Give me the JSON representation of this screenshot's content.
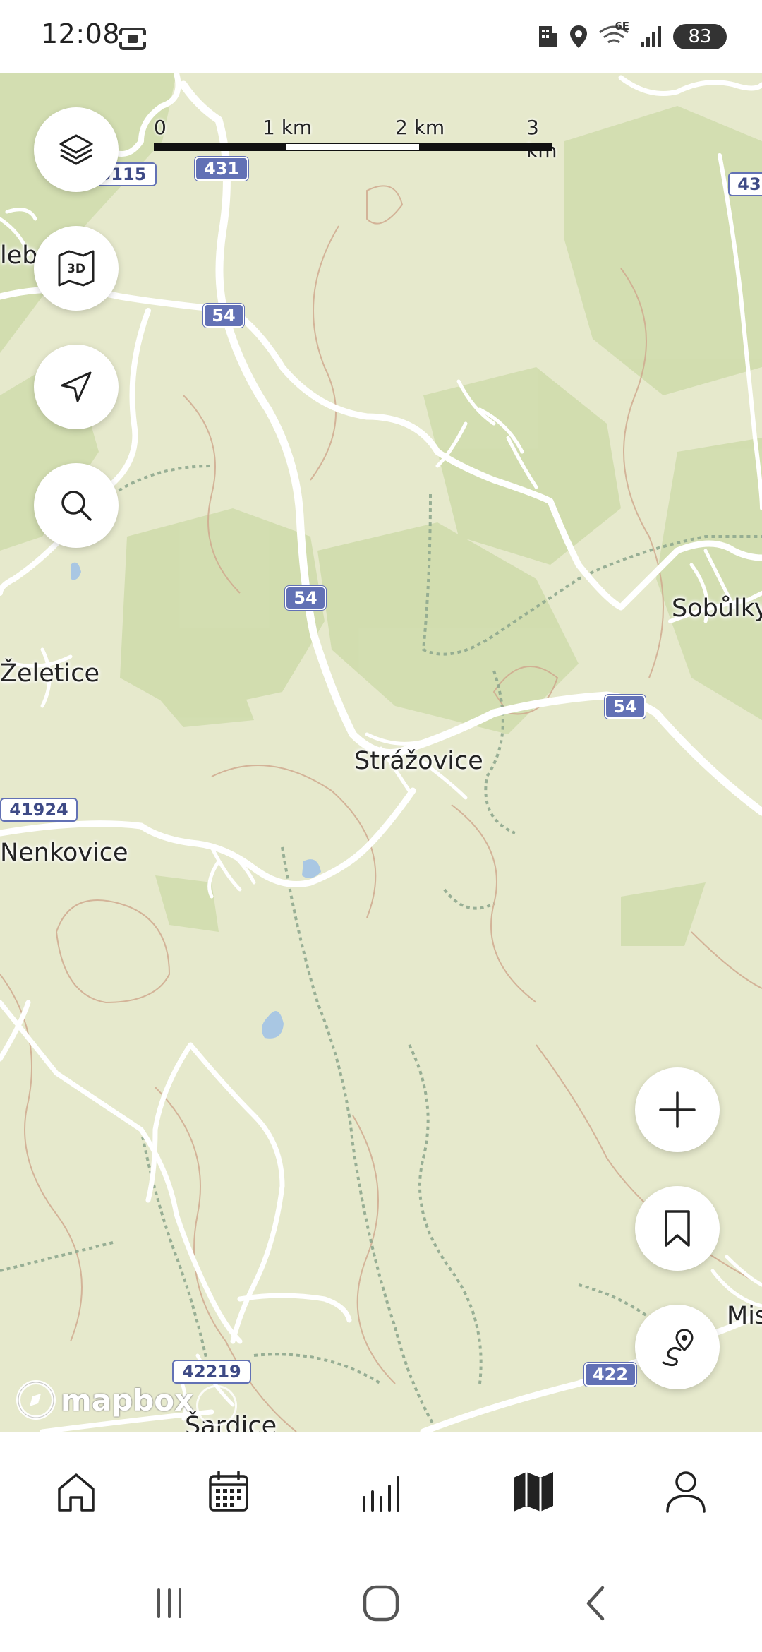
{
  "status_bar": {
    "time": "12:08",
    "battery": "83",
    "network": "6E"
  },
  "map": {
    "scale": {
      "labels": [
        "0",
        "1 km",
        "2 km",
        "3 km"
      ]
    },
    "places": {
      "strazovice": "Strážovice",
      "zeletice": "Želetice",
      "nenkovice": "Nenkovice",
      "sobulky": "Sobůlky",
      "sardice": "Šardice",
      "mis": "Mis",
      "leb": "leb"
    },
    "road_shields": {
      "r431": "431",
      "r431_right": "43",
      "r5115": "5115",
      "r54_a": "54",
      "r54_b": "54",
      "r54_c": "54",
      "r41924": "41924",
      "r42219": "42219",
      "r422": "422"
    },
    "attribution": "mapbox",
    "colors": {
      "land": "#e6e9cc",
      "forest": "#cfdcab",
      "road": "#ffffff",
      "contour": "#cfa98e",
      "path": "#8fa88f",
      "shield": "#6271b5"
    }
  },
  "map_controls": {
    "layers": "layers-icon",
    "view_3d": "3D",
    "locate": "navigation-arrow-icon",
    "search": "search-icon",
    "zoom_in": "plus-icon",
    "bookmark": "bookmark-icon",
    "route": "route-pin-icon"
  },
  "bottom_nav": {
    "items": [
      "home-icon",
      "calendar-icon",
      "stats-icon",
      "map-icon",
      "profile-icon"
    ],
    "active": "map-icon"
  },
  "system_nav": {
    "buttons": [
      "recents",
      "home",
      "back"
    ]
  }
}
